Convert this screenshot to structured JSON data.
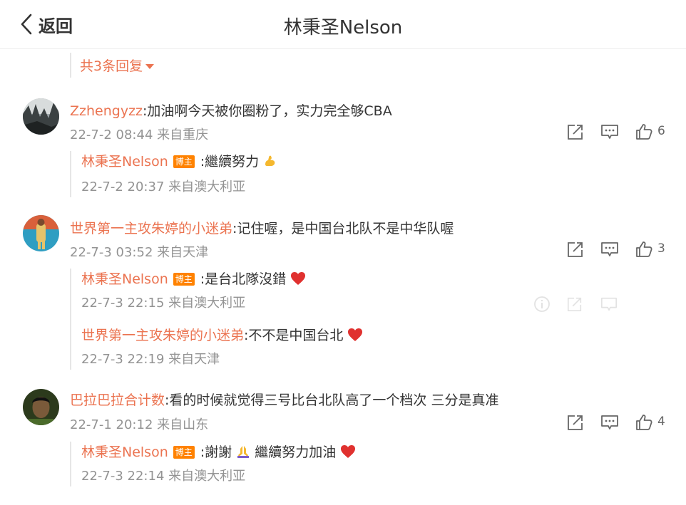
{
  "header": {
    "back_label": "返回",
    "title": "林秉圣Nelson"
  },
  "top_replies_more": "共3条回复",
  "comments": [
    {
      "user": "Zzhengyzz",
      "text": ":加油啊今天被你圈粉了，实力完全够CBA",
      "meta": "22-7-2 08:44 来自重庆",
      "likes": "6",
      "replies": [
        {
          "user": "林秉圣Nelson",
          "badge": "博主",
          "text": ":繼續努力",
          "meta": "22-7-2 20:37 来自澳大利亚"
        }
      ]
    },
    {
      "user": "世界第一主攻朱婷的小迷弟",
      "text": ":记住喔，是中国台北队不是中华队喔",
      "meta": "22-7-3 03:52 来自天津",
      "likes": "3",
      "replies": [
        {
          "user": "林秉圣Nelson",
          "badge": "博主",
          "text": ":是台北隊沒錯",
          "meta": "22-7-3 22:15 来自澳大利亚"
        },
        {
          "user": "世界第一主攻朱婷的小迷弟",
          "text": ":不不是中国台北",
          "meta": "22-7-3 22:19 来自天津"
        }
      ]
    },
    {
      "user": "巴拉巴拉合计数",
      "text": ":看的时候就觉得三号比台北队高了一个档次 三分是真准",
      "meta": "22-7-1 20:12 来自山东",
      "likes": "4",
      "replies": [
        {
          "user": "林秉圣Nelson",
          "badge": "博主",
          "text_a": ":謝謝",
          "text_b": "繼續努力加油",
          "meta": "22-7-3 22:14 来自澳大利亚"
        }
      ]
    }
  ],
  "colors": {
    "username": "#eb7350",
    "meta": "#939393",
    "badge": "#ff8200",
    "heart": "#e0312f"
  },
  "icons": [
    "back-chevron-icon",
    "share-icon",
    "comment-icon",
    "like-icon",
    "flexed-arm-emoji",
    "heart-emoji",
    "praying-hands-emoji"
  ]
}
